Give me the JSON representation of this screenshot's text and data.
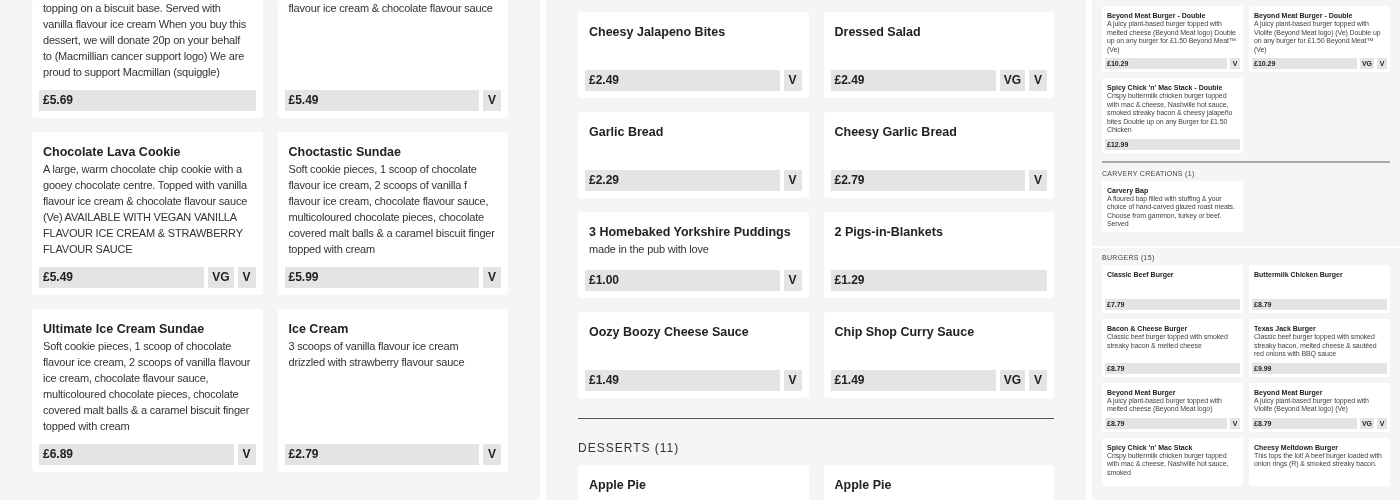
{
  "panels": [
    {
      "kind": "large",
      "screens": [
        {
          "sections": [
            {
              "cards": [
                {
                  "description": "topping on a biscuit base. Served with vanilla flavour ice cream When you buy this dessert, we will donate 20p on your behalf to (Macmillian cancer support logo) We are proud to support Macmillan (squiggle)",
                  "price": "£5.69"
                },
                {
                  "description": "flavour ice cream & chocolate flavour sauce",
                  "price": "£5.49",
                  "tags": [
                    "V"
                  ]
                },
                {
                  "title": "Chocolate Lava Cookie",
                  "description": "A large, warm chocolate chip cookie with a gooey chocolate centre. Topped with vanilla flavour ice cream & chocolate flavour sauce (Ve) AVAILABLE WITH VEGAN VANILLA FLAVOUR ICE CREAM & STRAWBERRY FLAVOUR SAUCE",
                  "price": "£5.49",
                  "tags": [
                    "VG",
                    "V"
                  ]
                },
                {
                  "title": "Choctastic Sundae",
                  "description": "Soft cookie pieces, 1 scoop of chocolate flavour ice cream, 2 scoops of vanilla f flavour ice cream, chocolate flavour sauce, multicoloured chocolate pieces, chocolate covered malt balls & a caramel biscuit finger topped with cream",
                  "price": "£5.99",
                  "tags": [
                    "V"
                  ]
                },
                {
                  "title": "Ultimate Ice Cream Sundae",
                  "description": "Soft cookie pieces, 1 scoop of chocolate flavour ice cream, 2 scoops of vanilla flavour ice cream, chocolate flavour sauce, multicoloured chocolate pieces, chocolate covered malt balls & a caramel biscuit finger topped with cream",
                  "price": "£6.89",
                  "tags": [
                    "V"
                  ]
                },
                {
                  "title": "Ice Cream",
                  "description": "3 scoops of vanilla flavour ice cream drizzled with strawberry flavour sauce",
                  "price": "£2.79",
                  "tags": [
                    "V"
                  ]
                }
              ]
            }
          ]
        }
      ]
    },
    {
      "kind": "large",
      "screens": [
        {
          "sections": [
            {
              "cards": [
                {
                  "title": "Cheesy Jalapeno Bites",
                  "price": "£2.49",
                  "tags": [
                    "V"
                  ]
                },
                {
                  "title": "Dressed Salad",
                  "price": "£2.49",
                  "tags": [
                    "VG",
                    "V"
                  ]
                },
                {
                  "title": "Garlic Bread",
                  "price": "£2.29",
                  "tags": [
                    "V"
                  ]
                },
                {
                  "title": "Cheesy Garlic Bread",
                  "price": "£2.79",
                  "tags": [
                    "V"
                  ]
                },
                {
                  "title": "3 Homebaked Yorkshire Puddings",
                  "description": "made in the pub with love",
                  "price": "£1.00",
                  "tags": [
                    "V"
                  ]
                },
                {
                  "title": "2 Pigs-in-Blankets",
                  "price": "£1.29"
                },
                {
                  "title": "Oozy Boozy Cheese Sauce",
                  "price": "£1.49",
                  "tags": [
                    "V"
                  ]
                },
                {
                  "title": "Chip Shop Curry Sauce",
                  "price": "£1.49",
                  "tags": [
                    "VG",
                    "V"
                  ]
                }
              ]
            },
            {
              "divider": true,
              "heading": "DESSERTS (11)",
              "cards": [
                {
                  "title": "Apple Pie"
                },
                {
                  "title": "Apple Pie"
                }
              ]
            }
          ]
        }
      ]
    },
    {
      "kind": "small",
      "screens": [
        {
          "sections": [
            {
              "cards": [
                {
                  "title": "Beyond Meat Burger - Double",
                  "description": "A juicy plant-based burger topped with melted cheese (Beyond Meat logo) Double up on any burger for £1.50 Beyond Meat™ (Ve)",
                  "price": "£10.29",
                  "tags": [
                    "V"
                  ]
                },
                {
                  "title": "Beyond Meat Burger - Double",
                  "description": "A juicy plant-based burger topped with Violife (Beyond Meat logo) (Ve) Double up on any burger for £1.50 Beyond Meat™ (Ve)",
                  "price": "£10.29",
                  "tags": [
                    "VG",
                    "V"
                  ]
                },
                {
                  "title": "Spicy Chick 'n' Mac Stack - Double",
                  "description": "Crispy buttermilk chicken burger topped with mac & cheese, Nashville hot sauce, smoked streaky bacon & cheesy jalapeño bites Double up on any Burger for £1.50 Chicken",
                  "price": "£12.99"
                }
              ]
            },
            {
              "divider": true,
              "heading": "CARVERY CREATIONS (1)",
              "cards": [
                {
                  "title": "Carvery Bap",
                  "description": "A floured bap filled with stuffing & your choice of hand-carved glazed roast meats. Choose from gammon, turkey or beef. Served"
                }
              ]
            }
          ]
        },
        {
          "sections": [
            {
              "heading": "BURGERS (15)",
              "cards": [
                {
                  "title": "Classic Beef Burger",
                  "price": "£7.79"
                },
                {
                  "title": "Buttermilk Chicken Burger",
                  "price": "£8.79"
                },
                {
                  "title": "Bacon & Cheese Burger",
                  "description": "Classic beef burger topped with smoked streaky bacon & melted cheese",
                  "price": "£8.79"
                },
                {
                  "title": "Texas Jack Burger",
                  "description": "Classic beef burger topped with smoked streaky bacon, melted cheese & sautéed red onions with BBQ sauce",
                  "price": "£9.99"
                },
                {
                  "title": "Beyond Meat Burger",
                  "description": "A juicy plant-based burger topped with melted cheese (Beyond Meat logo)",
                  "price": "£8.79",
                  "tags": [
                    "V"
                  ]
                },
                {
                  "title": "Beyond Meat Burger",
                  "description": "A juicy plant-based burger topped with Violife (Beyond Meat logo) (Ve)",
                  "price": "£8.79",
                  "tags": [
                    "VG",
                    "V"
                  ]
                },
                {
                  "title": "Spicy Chick 'n' Mac Stack",
                  "description": "Crispy buttermilk chicken burger topped with mac & cheese, Nashville hot sauce, smoked"
                },
                {
                  "title": "Cheesy Meltdown Burger",
                  "description": "This tops the lot! A beef burger loaded with onion rings (R) & smoked streaky bacon."
                }
              ]
            }
          ]
        }
      ]
    }
  ]
}
